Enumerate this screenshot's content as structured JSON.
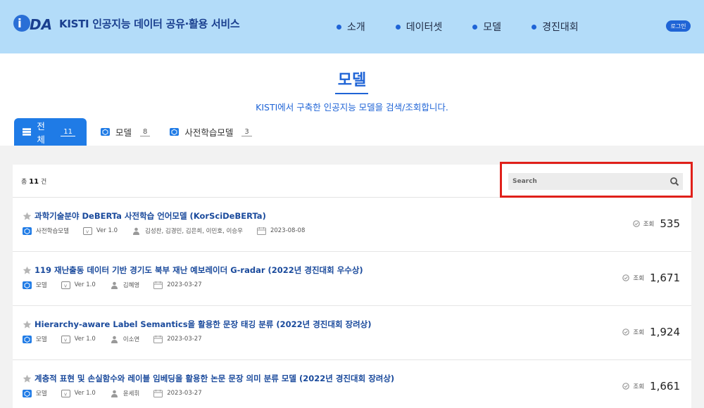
{
  "header": {
    "logo_text": "KISTI 인공지능 데이터 공유·활용 서비스",
    "nav": [
      "소개",
      "데이터셋",
      "모델",
      "경진대회"
    ],
    "login_label": "로그인"
  },
  "page": {
    "title": "모델",
    "subtitle": "KISTI에서 구축한 인공지능 모델을 검색/조회합니다."
  },
  "tabs": [
    {
      "label": "전체",
      "count": "11",
      "icon": "list-icon"
    },
    {
      "label": "모델",
      "count": "8",
      "icon": "cube-icon"
    },
    {
      "label": "사전학습모델",
      "count": "3",
      "icon": "cube-icon"
    }
  ],
  "list_header": {
    "total_prefix": "총",
    "total_count": "11",
    "total_suffix": "건",
    "search_placeholder": "Search"
  },
  "views_label": "조회",
  "items": [
    {
      "title": "과학기술분야 DeBERTa 사전학습 언어모델 (KorSciDeBERTa)",
      "type": "사전학습모델",
      "version": "Ver 1.0",
      "authors": "김성찬, 김경민, 김은희, 이민호, 이승우",
      "date": "2023-08-08",
      "views": "535"
    },
    {
      "title": "119 재난출동 데이터 기반 경기도 북부 재난 예보레이더 G-radar (2022년 경진대회 우수상)",
      "type": "모델",
      "version": "Ver 1.0",
      "authors": "김혜영",
      "date": "2023-03-27",
      "views": "1,671"
    },
    {
      "title": "Hierarchy-aware Label Semantics을 활용한 문장 태깅 분류 (2022년 경진대회 장려상)",
      "type": "모델",
      "version": "Ver 1.0",
      "authors": "이소연",
      "date": "2023-03-27",
      "views": "1,924"
    },
    {
      "title": "계층적 표현 및 손실함수와 레이블 임베딩을 활용한 논문 문장 의미 분류 모델 (2022년 경진대회 장려상)",
      "type": "모델",
      "version": "Ver 1.0",
      "authors": "윤세휘",
      "date": "2023-03-27",
      "views": "1,661"
    }
  ],
  "colors": {
    "header_bg": "#b3dcf9",
    "accent": "#1f64d6",
    "active_tab": "#1f7be6",
    "highlight_border": "#e0201a"
  }
}
